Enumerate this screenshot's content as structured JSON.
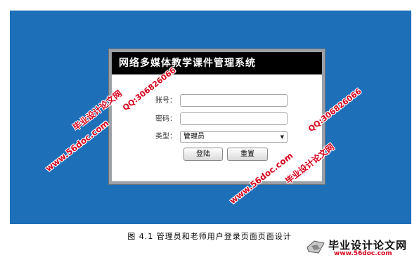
{
  "dialog": {
    "title": "网络多媒体教学课件管理系统",
    "account_label": "账号：",
    "account_value": "",
    "password_label": "密码：",
    "password_value": "",
    "type_label": "类型：",
    "type_selected": "管理员",
    "login_button": "登陆",
    "reset_button": "重置"
  },
  "caption": "图 4.1 管理员和老师用户登录页面页面设计",
  "watermarks": {
    "site_name": "毕业设计论文网",
    "url": "www.56doc.com",
    "qq": "QQ:306826066"
  },
  "logo": {
    "main": "毕业设计论文网",
    "url": "www.56doc.com"
  },
  "colors": {
    "screen_bg": "#1d6fb8",
    "title_bar": "#000000",
    "watermark": "#d6001c"
  }
}
